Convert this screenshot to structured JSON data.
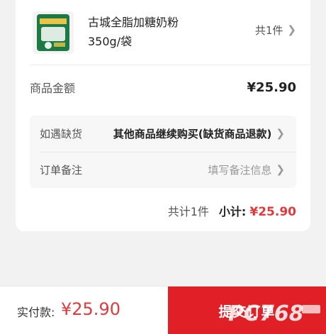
{
  "product": {
    "name_line1": "古城全脂加糖奶粉",
    "name_line2": "350g/袋",
    "quantity": "共1件",
    "thumb_colors": {
      "package": "#1e7a45",
      "accent": "#e8c44a"
    }
  },
  "amount": {
    "label": "商品金额",
    "value": "¥25.90"
  },
  "options": {
    "stockout": {
      "label": "如遇缺货",
      "value": "其他商品继续购买(缺货商品退款)"
    },
    "remark": {
      "label": "订单备注",
      "placeholder": "填写备注信息"
    }
  },
  "summary": {
    "count": "共计1件",
    "subtotal_label": "小计:",
    "subtotal_value": "¥25.90"
  },
  "bottom_bar": {
    "pay_label": "实付款:",
    "pay_value": "¥25.90",
    "submit_label": "提交订单"
  },
  "colors": {
    "price_red": "#e4393c",
    "submit_red": "#e01f26"
  }
}
